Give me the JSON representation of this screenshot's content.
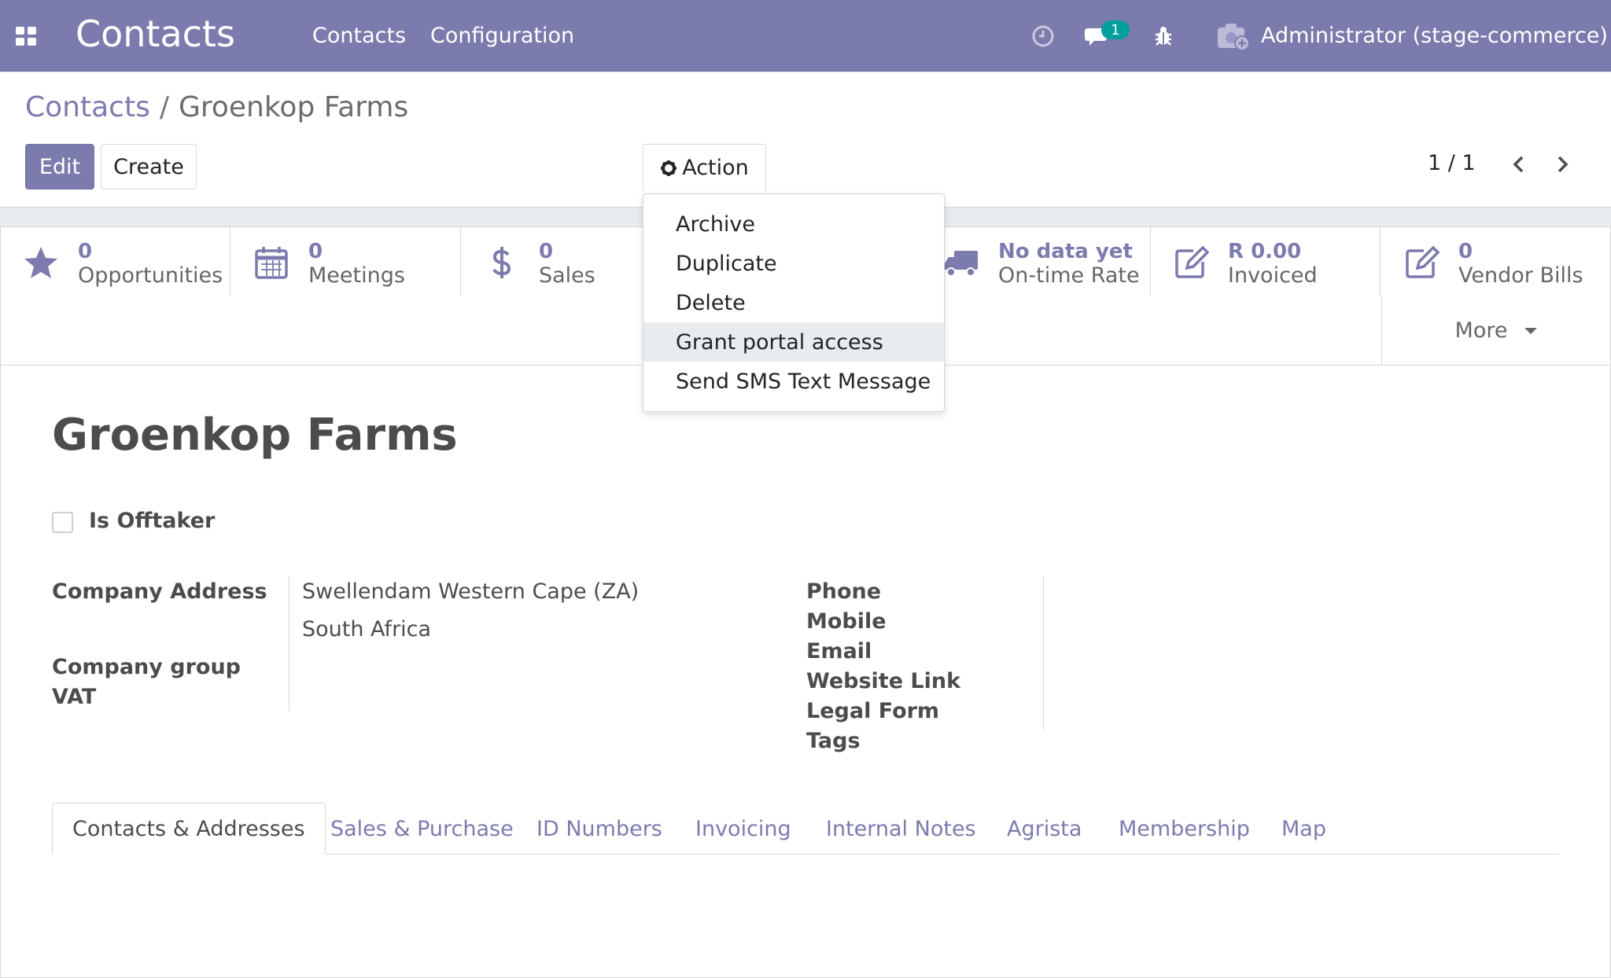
{
  "navbar": {
    "app_title": "Contacts",
    "menu": [
      "Contacts",
      "Configuration"
    ],
    "icons": [
      "apps-grid-icon",
      "clock-icon",
      "chat-icon",
      "bug-icon",
      "user-avatar-icon"
    ],
    "message_count": "1",
    "user": "Administrator (stage-commerce)",
    "color": "#7c7bad",
    "badge_color": "#00a09d"
  },
  "breadcrumb": {
    "parent": "Contacts",
    "separator": "/",
    "current": "Groenkop Farms"
  },
  "toolbar": {
    "edit_label": "Edit",
    "create_label": "Create",
    "action_label": "Action",
    "pager": "1 / 1"
  },
  "action_menu": {
    "items": [
      "Archive",
      "Duplicate",
      "Delete",
      "Grant portal access",
      "Send SMS Text Message"
    ],
    "highlighted": "Grant portal access"
  },
  "stat_buttons": [
    {
      "icon": "star-icon",
      "value": "0",
      "label": "Opportunities"
    },
    {
      "icon": "calendar-icon",
      "value": "0",
      "label": "Meetings"
    },
    {
      "icon": "dollar-icon",
      "value": "0",
      "label": "Sales"
    },
    {
      "icon": "truck-icon",
      "value": "No data yet",
      "label": "On-time Rate"
    },
    {
      "icon": "edit-icon",
      "value": "R 0.00",
      "label": "Invoiced"
    },
    {
      "icon": "edit-icon",
      "value": "0",
      "label": "Vendor Bills"
    }
  ],
  "more_label": "More",
  "record": {
    "name": "Groenkop Farms",
    "is_offtaker_label": "Is Offtaker",
    "is_offtaker": false
  },
  "left_fields": {
    "company_address_label": "Company Address",
    "address_line1": "Swellendam  Western Cape (ZA)",
    "address_line2": "South Africa",
    "company_group_label": "Company group",
    "vat_label": "VAT"
  },
  "right_fields": {
    "labels": [
      "Phone",
      "Mobile",
      "Email",
      "Website Link",
      "Legal Form",
      "Tags"
    ]
  },
  "tabs": [
    "Contacts & Addresses",
    "Sales & Purchase",
    "ID Numbers",
    "Invoicing",
    "Internal Notes",
    "Agrista",
    "Membership",
    "Map"
  ],
  "active_tab": "Contacts & Addresses"
}
